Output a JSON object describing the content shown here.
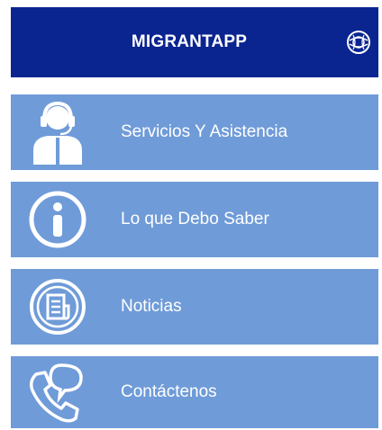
{
  "header": {
    "title": "MIGRANTAPP",
    "logo_icon": "globe-logo-icon"
  },
  "menu": {
    "items": [
      {
        "label": "Servicios Y Asistencia",
        "icon": "support-agent-icon"
      },
      {
        "label": "Lo que Debo Saber",
        "icon": "info-icon"
      },
      {
        "label": "Noticias",
        "icon": "news-icon"
      },
      {
        "label": "Contáctenos",
        "icon": "phone-chat-icon"
      }
    ]
  },
  "colors": {
    "header_bg": "#0a2590",
    "item_bg": "#6f9bd8",
    "text": "#ffffff"
  }
}
